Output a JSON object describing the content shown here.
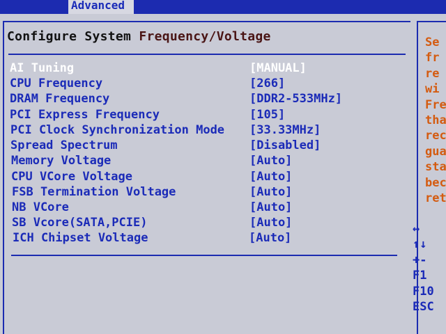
{
  "topbar": {
    "active_tab": "Advanced"
  },
  "section": {
    "title_part1": "Configure System ",
    "title_part2": "Frequency/Voltage"
  },
  "settings": [
    {
      "label": "AI Tuning",
      "value": "[MANUAL]",
      "selected": true
    },
    {
      "label": "CPU Frequency",
      "value": "[266]"
    },
    {
      "label": "DRAM Frequency",
      "value": "[DDR2-533MHz]"
    },
    {
      "label": "PCI Express Frequency",
      "value": "[105]"
    },
    {
      "label": "PCI Clock Synchronization Mode",
      "value": "[33.33MHz]"
    },
    {
      "label": "Spread Spectrum",
      "value": "[Disabled]"
    },
    {
      "label": "Memory Voltage",
      "value": "[Auto]"
    },
    {
      "label": "CPU VCore Voltage",
      "value": "[Auto]"
    },
    {
      "label": "FSB Termination Voltage",
      "value": "[Auto]"
    },
    {
      "label": "NB VCore",
      "value": "[Auto]"
    },
    {
      "label": "SB Vcore(SATA,PCIE)",
      "value": "[Auto]"
    },
    {
      "label": "ICH Chipset Voltage",
      "value": "[Auto]"
    }
  ],
  "help_lines": [
    "Se",
    "fr",
    "re",
    "wi",
    "Fre",
    "tha",
    "rec",
    "gua",
    "sta",
    "bec",
    "ret"
  ],
  "keys": [
    "↔",
    "↑↓",
    "+-",
    "F1",
    "F10",
    "ESC"
  ],
  "colors": {
    "topbar": "#1c2bb0",
    "background": "#c9cbd6",
    "item_text": "#1b2bb8",
    "selected_text": "#ffffff",
    "help_text": "#d45b10"
  }
}
